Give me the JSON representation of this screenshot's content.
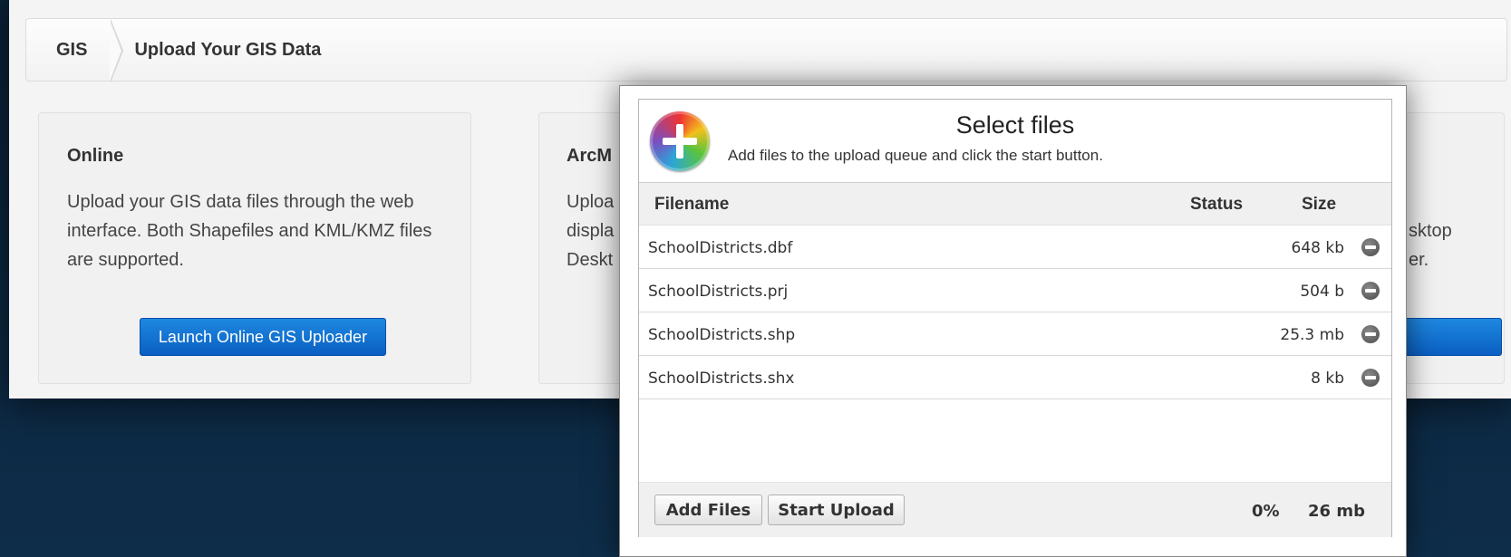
{
  "breadcrumb": {
    "home": "GIS",
    "current": "Upload Your GIS Data"
  },
  "cards": {
    "online": {
      "title": "Online",
      "body": "Upload your GIS data files through the web interface. Both Shapefiles and KML/KMZ files are supported.",
      "button": "Launch Online GIS Uploader"
    },
    "arcmap": {
      "title": "ArcM",
      "lines": [
        "Uploa",
        "displa",
        "Deskt"
      ]
    },
    "desktop": {
      "lines": [
        "sktop",
        "er."
      ]
    }
  },
  "uploader": {
    "title": "Select files",
    "subtitle": "Add files to the upload queue and click the start button.",
    "columns": {
      "filename": "Filename",
      "status": "Status",
      "size": "Size"
    },
    "files": [
      {
        "name": "SchoolDistricts.dbf",
        "size": "648 kb"
      },
      {
        "name": "SchoolDistricts.prj",
        "size": "504 b"
      },
      {
        "name": "SchoolDistricts.shp",
        "size": "25.3 mb"
      },
      {
        "name": "SchoolDistricts.shx",
        "size": "8 kb"
      }
    ],
    "add_files_label": "Add Files",
    "start_upload_label": "Start Upload",
    "progress": "0%",
    "total_size": "26 mb"
  },
  "colors": {
    "background": "#0c2740",
    "accent_button": "#0a5fc2"
  }
}
